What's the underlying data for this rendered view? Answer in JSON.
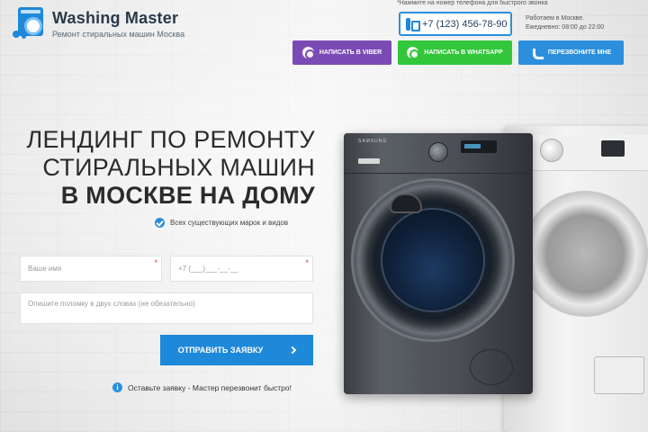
{
  "header": {
    "logo_title": "Washing Master",
    "logo_subtitle": "Ремонт стиральных машин Москва",
    "note": "*Нажмите на номер телефона для быстрого звонка",
    "phone": "+7 (123) 456-78-90",
    "work_hours_line1": "Работаем в Москве.",
    "work_hours_line2": "Ежедневно: 08:00 до 22:00"
  },
  "contact_buttons": {
    "viber": "Написать в Viber",
    "whatsapp": "Написать в WhatsApp",
    "callback": "Перезвоните мне"
  },
  "hero": {
    "line1": "ЛЕНДИНГ ПО РЕМОНТУ",
    "line2": "СТИРАЛЬНЫХ МАШИН",
    "line3": "В МОСКВЕ НА ДОМУ",
    "brands": "Всех существующих марок и видов"
  },
  "form": {
    "name_placeholder": "Ваше имя",
    "phone_placeholder": "+7 (___)___-__-__",
    "message_placeholder": "Опишите поломку в двух словах (не обязательно)",
    "required_mark": "*",
    "submit": "Отправить заявку",
    "hint": "Оставьте заявку - Мастер перезвонит быстро!"
  },
  "machine": {
    "brand": "SAMSUNG"
  },
  "colors": {
    "accent": "#1e88d9",
    "viber": "#7b4bb5",
    "whatsapp": "#32c63a"
  }
}
